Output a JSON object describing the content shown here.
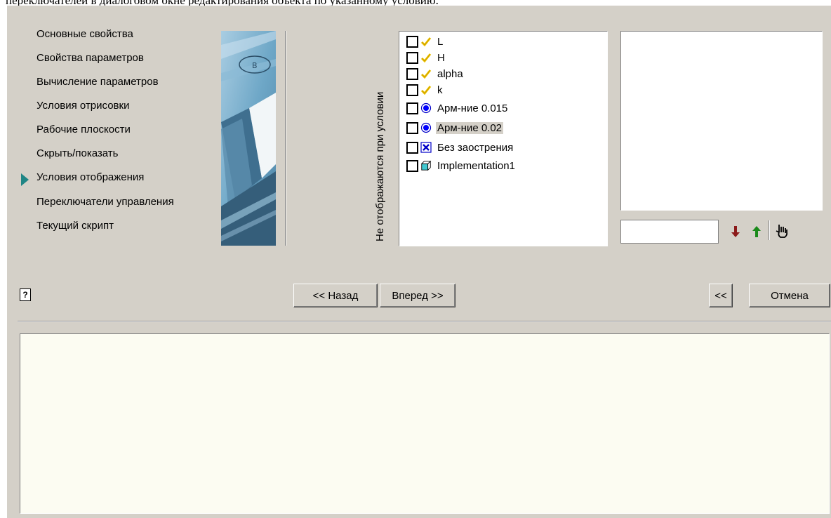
{
  "caption": "переключателей в диалоговом окне редактирования объекта по указанному условию.",
  "nav": {
    "items": [
      {
        "label": "Основные свойства"
      },
      {
        "label": "Свойства параметров"
      },
      {
        "label": "Вычисление параметров"
      },
      {
        "label": "Условия отрисовки"
      },
      {
        "label": "Рабочие плоскости"
      },
      {
        "label": "Скрыть/показать"
      },
      {
        "label": "Условия отображения",
        "active": true
      },
      {
        "label": "Переключатели управления"
      },
      {
        "label": "Текущий скрипт"
      }
    ]
  },
  "conditions": {
    "vertical_label": "Не отображаются при условии",
    "items": [
      {
        "label": "L",
        "icon": "parameter-check-icon"
      },
      {
        "label": "H",
        "icon": "parameter-check-icon"
      },
      {
        "label": "alpha",
        "icon": "parameter-check-icon"
      },
      {
        "label": "k",
        "icon": "parameter-check-icon"
      },
      {
        "label": "Арм-ние 0.015",
        "icon": "radio-option-icon"
      },
      {
        "label": "Арм-ние 0.02",
        "icon": "radio-option-icon",
        "selected": true
      },
      {
        "label": "Без заострения",
        "icon": "checkbox-x-icon"
      },
      {
        "label": "Implementation1",
        "icon": "cube-icon"
      }
    ]
  },
  "buttons": {
    "back": "<< Назад",
    "next": "Вперед >>",
    "collapse": "<<",
    "cancel": "Отмена"
  },
  "help": {
    "glyph": "?"
  },
  "colors": {
    "dialog_bg": "#d4d0c8",
    "active_arrow": "#1f8585",
    "arrow_down": "#8b1a1a",
    "arrow_up": "#1a8a1a",
    "description_bg": "#fcfcf2"
  }
}
